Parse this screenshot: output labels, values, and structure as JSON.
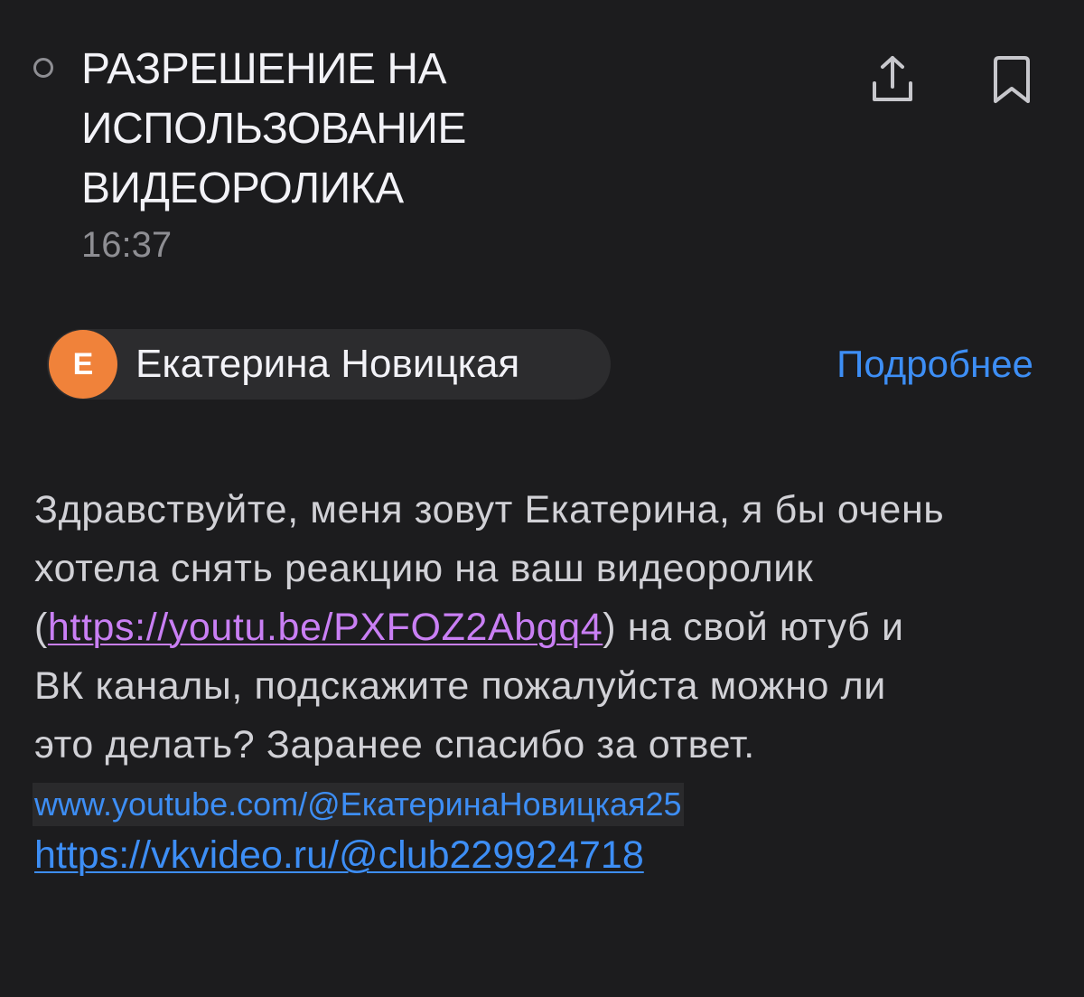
{
  "header": {
    "subject_lines": [
      "РАЗРЕШЕНИЕ НА",
      "ИСПОЛЬЗОВАНИЕ",
      "ВИДЕОРОЛИКА"
    ],
    "time": "16:37",
    "actions": [
      {
        "icon": "share-icon"
      },
      {
        "icon": "bookmark-icon"
      }
    ]
  },
  "sender": {
    "avatar_letter": "Е",
    "avatar_color": "#f0823a",
    "name": "Екатерина Новицкая",
    "details_label": "Подробнее"
  },
  "message": {
    "line1": "Здравствуйте, меня зовут Екатерина, я бы очень",
    "line2": "хотела снять реакцию на ваш видеоролик",
    "line3_prefix": "(",
    "line3_link": "https://youtu.be/PXFOZ2Abgq4",
    "line3_suffix": ") на свой ютуб и",
    "line4": "ВК каналы, подскажите пожалуйста можно ли",
    "line5": "это делать? Заранее спасибо за ответ.",
    "youtube_link": "www.youtube.com/@ЕкатеринаНовицкая25",
    "vk_link": "https://vkvideo.ru/@club229924718"
  },
  "colors": {
    "background": "#1c1c1e",
    "link_blue": "#3d8ef5",
    "link_purple": "#c97ff4",
    "muted": "#8e8e93"
  }
}
